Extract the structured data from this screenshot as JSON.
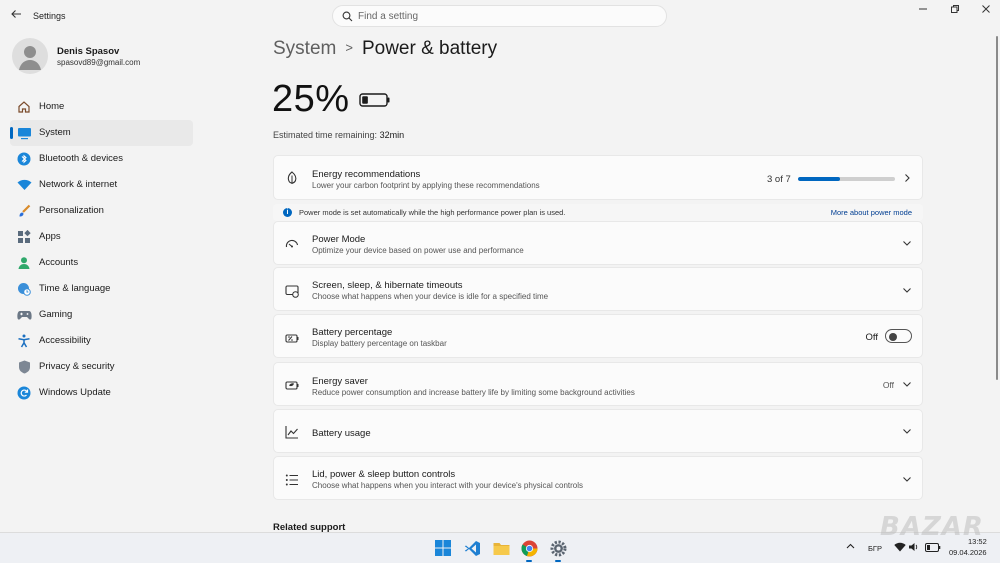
{
  "window": {
    "app_title": "Settings",
    "search_placeholder": "Find a setting"
  },
  "profile": {
    "name": "Denis Spasov",
    "email": "spasovd89@gmail.com"
  },
  "sidebar": {
    "items": [
      {
        "label": "Home",
        "icon": "home-icon",
        "active": false
      },
      {
        "label": "System",
        "icon": "system-icon",
        "active": true
      },
      {
        "label": "Bluetooth & devices",
        "icon": "bluetooth-icon",
        "active": false
      },
      {
        "label": "Network & internet",
        "icon": "wifi-icon",
        "active": false
      },
      {
        "label": "Personalization",
        "icon": "brush-icon",
        "active": false
      },
      {
        "label": "Apps",
        "icon": "apps-icon",
        "active": false
      },
      {
        "label": "Accounts",
        "icon": "accounts-icon",
        "active": false
      },
      {
        "label": "Time & language",
        "icon": "globe-clock-icon",
        "active": false
      },
      {
        "label": "Gaming",
        "icon": "gamepad-icon",
        "active": false
      },
      {
        "label": "Accessibility",
        "icon": "accessibility-icon",
        "active": false
      },
      {
        "label": "Privacy & security",
        "icon": "shield-icon",
        "active": false
      },
      {
        "label": "Windows Update",
        "icon": "update-icon",
        "active": false
      }
    ]
  },
  "main": {
    "breadcrumb_parent": "System",
    "breadcrumb_separator": ">",
    "breadcrumb_current": "Power & battery",
    "battery_percent": "25%",
    "battery_level": 0.25,
    "est_label": "Estimated time remaining:",
    "est_value": "32min",
    "energy_recommendations": {
      "title": "Energy recommendations",
      "subtitle": "Lower your carbon footprint by applying these recommendations",
      "progress_text": "3 of 7",
      "progress_fraction": 0.43
    },
    "info": {
      "text": "Power mode is set automatically while the high performance power plan is used.",
      "link": "More about power mode"
    },
    "power_mode": {
      "title": "Power Mode",
      "subtitle": "Optimize your device based on power use and performance"
    },
    "timeouts": {
      "title": "Screen, sleep, & hibernate timeouts",
      "subtitle": "Choose what happens when your device is idle for a specified time"
    },
    "battery_percentage": {
      "title": "Battery percentage",
      "subtitle": "Display battery percentage on taskbar",
      "state": "Off"
    },
    "energy_saver": {
      "title": "Energy saver",
      "subtitle": "Reduce power consumption and increase battery life by limiting some background activities",
      "state": "Off"
    },
    "battery_usage": {
      "title": "Battery usage"
    },
    "lid_controls": {
      "title": "Lid, power & sleep button controls",
      "subtitle": "Choose what happens when you interact with your device's physical controls"
    },
    "related_support": "Related support"
  },
  "taskbar": {
    "language": "БГР",
    "time": "13:52",
    "date": "09.04.2026"
  },
  "watermark": "BAZAR",
  "colors": {
    "accent": "#0067c0",
    "background": "#f3f3f3",
    "card": "#fbfbfb"
  }
}
